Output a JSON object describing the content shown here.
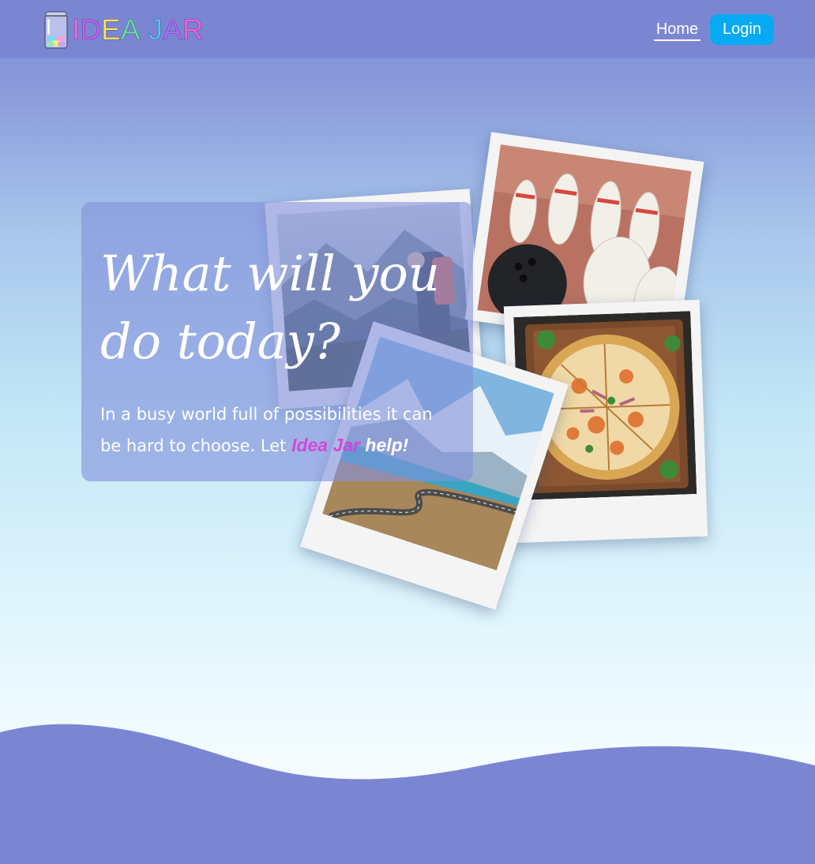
{
  "nav": {
    "logo_letters": [
      {
        "char": "I",
        "color": "#f26de0"
      },
      {
        "char": "D",
        "color": "#c65ff1"
      },
      {
        "char": "E",
        "color": "#f5e65a"
      },
      {
        "char": "A",
        "color": "#66e0a0"
      },
      {
        "char": " ",
        "color": "#ffffff"
      },
      {
        "char": "J",
        "color": "#5bc2f5"
      },
      {
        "char": "A",
        "color": "#b16ef3"
      },
      {
        "char": "R",
        "color": "#f064d8"
      }
    ],
    "logo_icon": "jar-icon",
    "home_label": "Home",
    "login_label": "Login"
  },
  "hero": {
    "title_line1": "What will you",
    "title_line2": "do today?",
    "subtitle_prefix": "In a busy world full of possibilities it can be hard to choose. Let ",
    "brand_text": "Idea Jar",
    "subtitle_suffix": " help!"
  },
  "photos": [
    "hiker-photo",
    "bowling-photo",
    "pizza-photo",
    "mountain-road-photo"
  ],
  "colors": {
    "navbar": "#7b86d3",
    "login_button": "#06aaf2",
    "brand_accent": "#d546d8",
    "wave": "#7b86d3"
  }
}
